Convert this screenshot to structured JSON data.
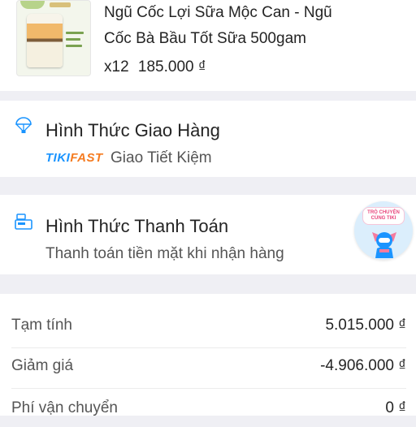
{
  "product": {
    "image_icon": "product-thumbnail",
    "title_line1": "Ngũ Cốc Lợi Sữa Mộc Can - Ngũ",
    "title_line2": "Cốc Bà Bầu Tốt Sữa 500gam",
    "quantity": "x12",
    "price": "185.000 ₫"
  },
  "delivery": {
    "icon": "parachute-icon",
    "title": "Hình Thức Giao Hàng",
    "badge_tiki": "TIKI",
    "badge_fast": "FAST",
    "method": "Giao Tiết Kiệm"
  },
  "payment": {
    "icon": "cash-register-icon",
    "title": "Hình Thức Thanh Toán",
    "method": "Thanh toán tiền mặt khi nhận hàng"
  },
  "chat": {
    "label_line1": "TRÒ CHUYỆN",
    "label_line2": "CÙNG TIKI"
  },
  "summary": {
    "rows": [
      {
        "label": "Tạm tính",
        "value": "5.015.000 ₫"
      },
      {
        "label": "Giảm giá",
        "value": "-4.906.000 ₫"
      },
      {
        "label": "Phí vận chuyển",
        "value": "0 ₫"
      }
    ]
  },
  "colors": {
    "tiki_blue": "#1a94ff",
    "fast_orange": "#f57b20",
    "background": "#efeff4"
  }
}
